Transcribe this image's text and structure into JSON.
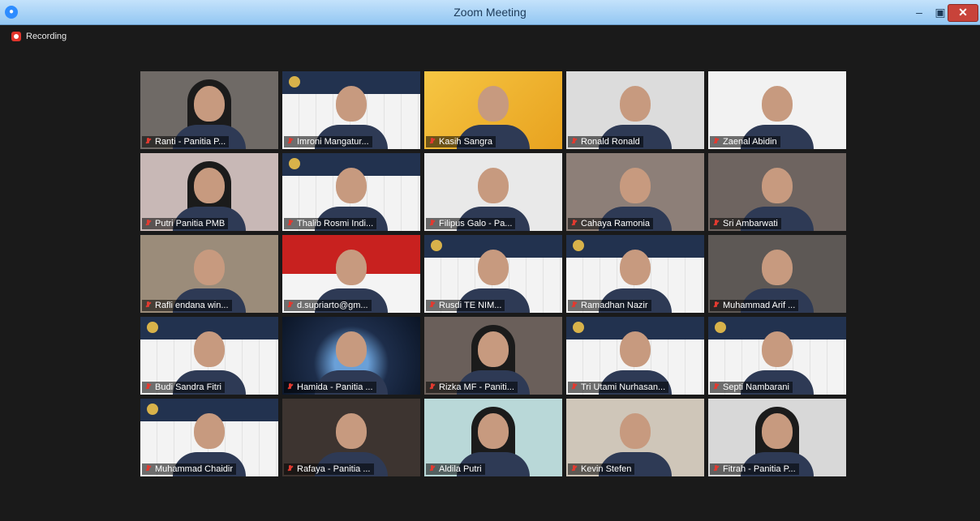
{
  "window": {
    "title": "Zoom Meeting",
    "minimize": "–",
    "maximize": "▣",
    "close": "✕"
  },
  "recording": {
    "label": "Recording"
  },
  "participants": [
    {
      "name": "Ranti - Panitia P...",
      "bg": "#6f6a66",
      "kind": "hijab"
    },
    {
      "name": "Imroni Mangatur...",
      "bg": "#f0f0f0",
      "kind": "slide"
    },
    {
      "name": "Kasih Sangra",
      "bg": "#f1b52a",
      "kind": "banner"
    },
    {
      "name": "Ronald Ronald",
      "bg": "#dcdcdc",
      "kind": "person"
    },
    {
      "name": "Zaenal Abidin",
      "bg": "#f2f2f2",
      "kind": "person"
    },
    {
      "name": "Putri Panitia PMB",
      "bg": "#c8b8b6",
      "kind": "hijab"
    },
    {
      "name": "Thalib Rosmi Indi...",
      "bg": "#f0f0f0",
      "kind": "slide"
    },
    {
      "name": "Filipus Galo - Pa...",
      "bg": "#e9e9e9",
      "kind": "person"
    },
    {
      "name": "Cahaya Ramonia",
      "bg": "#8d7f78",
      "kind": "person"
    },
    {
      "name": "Sri Ambarwati",
      "bg": "#6e6460",
      "kind": "person"
    },
    {
      "name": "Rafli endana win...",
      "bg": "#9b8c7a",
      "kind": "person"
    },
    {
      "name": "d.supriarto@gm...",
      "bg": "#c8211f",
      "kind": "flag"
    },
    {
      "name": "Rusdi TE NIM...",
      "bg": "#e3e3e3",
      "kind": "slide"
    },
    {
      "name": "Ramadhan Nazir",
      "bg": "#ececec",
      "kind": "slide"
    },
    {
      "name": "Muhammad Arif ...",
      "bg": "#5d5855",
      "kind": "person"
    },
    {
      "name": "Budi Sandra Fitri",
      "bg": "#f0f0f0",
      "kind": "slide"
    },
    {
      "name": "Hamida - Panitia ...",
      "bg": "#1d2d4a",
      "kind": "space"
    },
    {
      "name": "Rizka MF - Paniti...",
      "bg": "#6a5f5a",
      "kind": "hijab"
    },
    {
      "name": "Tri Utami Nurhasan...",
      "bg": "#e7e7e7",
      "kind": "slide",
      "active": true
    },
    {
      "name": "Septi Nambarani",
      "bg": "#ececec",
      "kind": "slide"
    },
    {
      "name": "Muhammad Chaidir",
      "bg": "#f0f0f0",
      "kind": "slide"
    },
    {
      "name": "Rafaya - Panitia ...",
      "bg": "#3d3430",
      "kind": "person"
    },
    {
      "name": "Aldila Putri",
      "bg": "#b9d8d8",
      "kind": "hijab"
    },
    {
      "name": "Kevin Stefen",
      "bg": "#cfc6b9",
      "kind": "person"
    },
    {
      "name": "Fitrah - Panitia P...",
      "bg": "#d8d8d8",
      "kind": "hijab"
    }
  ]
}
